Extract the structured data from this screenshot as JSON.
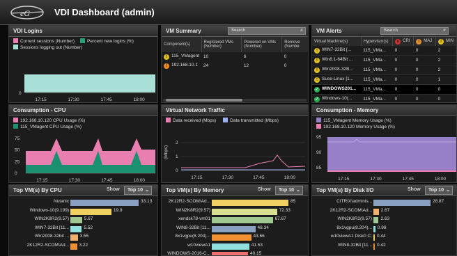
{
  "header": {
    "title": "VDI Dashboard (admin)"
  },
  "logins": {
    "title": "VDI Logins",
    "legend": [
      {
        "label": "Current sessions (Number)",
        "color": "#e97fb0"
      },
      {
        "label": "Percent new logins (%)",
        "color": "#27a07a"
      },
      {
        "label": "Sessions logging out (Number)",
        "color": "#a8e0d8"
      }
    ],
    "xticks": [
      "17:15",
      "17:30",
      "17:45",
      "18:00"
    ],
    "ytick": "0"
  },
  "summary": {
    "title": "VM Summary",
    "search": "Search",
    "cols": [
      "Component(s)",
      "Registered VMs (Number)",
      "Powered on VMs (Number)",
      "Remove (Numbe"
    ],
    "rows": [
      {
        "status": "!",
        "color": "#e0c020",
        "name": "115_VMagent",
        "reg": "10",
        "on": "6",
        "rem": "0"
      },
      {
        "status": "!",
        "color": "#f08a20",
        "name": "192.168.10.1",
        "reg": "24",
        "on": "12",
        "rem": "0"
      }
    ]
  },
  "alerts": {
    "title": "VM Alerts",
    "search": "Search",
    "cols": [
      "Virtual Machine(s)",
      "Hypervisor(s)",
      "CRI",
      "MAJ",
      "MIN"
    ],
    "rows": [
      {
        "icon": "!",
        "color": "#e0c020",
        "vm": "WIN7-32Bit [...",
        "hv": "115_VMa...",
        "cri": "0",
        "maj": "0",
        "min": "2"
      },
      {
        "icon": "!",
        "color": "#e0c020",
        "vm": "Win8.1-64Bit ...",
        "hv": "115_VMa...",
        "cri": "0",
        "maj": "0",
        "min": "2"
      },
      {
        "icon": "!",
        "color": "#e0c020",
        "vm": "Win2008-32B...",
        "hv": "115_VMa...",
        "cri": "0",
        "maj": "0",
        "min": "2"
      },
      {
        "icon": "!",
        "color": "#e0c020",
        "vm": "Suse-Linux [1...",
        "hv": "115_VMa...",
        "cri": "0",
        "maj": "0",
        "min": "1"
      },
      {
        "icon": "✓",
        "color": "#27b050",
        "vm": "WINDOWS201...",
        "hv": "115_VMa...",
        "cri": "0",
        "maj": "0",
        "min": "0"
      },
      {
        "icon": "✓",
        "color": "#27b050",
        "vm": "Windows-10(...",
        "hv": "115_VMa...",
        "cri": "0",
        "maj": "0",
        "min": "0"
      }
    ]
  },
  "cpu": {
    "title": "Consumption - CPU",
    "legend": [
      {
        "label": "192.168.10.120 CPU Usage (%)",
        "color": "#e97fb0"
      },
      {
        "label": "115_VMagent CPU Usage (%)",
        "color": "#1a9070"
      }
    ],
    "yticks": [
      "75",
      "50",
      "25",
      "0"
    ],
    "xticks": [
      "17:15",
      "17:30",
      "17:45",
      "18:00"
    ]
  },
  "net": {
    "title": "Virtual Network Traffic",
    "legend": [
      {
        "label": "Data received (Mbps)",
        "color": "#e97fb0"
      },
      {
        "label": "Data transmitted (Mbps)",
        "color": "#9ab0f0"
      }
    ],
    "ylabel": "(Mbps)",
    "yticks": [
      "2",
      "1",
      "0"
    ],
    "xticks": [
      "17:15",
      "17:30",
      "17:45",
      "18:00"
    ]
  },
  "mem": {
    "title": "Consumption - Memory",
    "legend": [
      {
        "label": "115_VMagent Memory Usage (%)",
        "color": "#9880c8"
      },
      {
        "label": "192.168.10.120 Memory Usage (%)",
        "color": "#e97fb0"
      }
    ],
    "yticks": [
      "95",
      "90",
      "85"
    ],
    "xticks": [
      "17:15",
      "17:30",
      "17:45",
      "18:00"
    ]
  },
  "topcpu": {
    "title": "Top VM(s) By CPU",
    "show": "Show",
    "select": "Top 10",
    "max": 33.13,
    "items": [
      {
        "name": "Nutanix",
        "value": 33.13,
        "color": "#8aa0c0"
      },
      {
        "name": "Windows-10(9.199)",
        "value": 19.9,
        "color": "#f0d060"
      },
      {
        "name": "WIN2K8R2(9.57)",
        "value": 5.67,
        "color": "#a0c890"
      },
      {
        "name": "WIN7-32Bit [11...",
        "value": 5.52,
        "color": "#90e0e0"
      },
      {
        "name": "Win2008-32bit ...",
        "value": 3.55,
        "color": "#f0b070"
      },
      {
        "name": "2K12R2-SCOM\\Ad...",
        "value": 3.22,
        "color": "#f09030"
      }
    ]
  },
  "topmem": {
    "title": "Top VM(s) By Memory",
    "show": "Show",
    "select": "Top 10",
    "max": 85,
    "items": [
      {
        "name": "2K12R2-SCOM\\Ad...",
        "value": 85,
        "color": "#f0d060"
      },
      {
        "name": "WIN2K8R2(9.57)",
        "value": 72.33,
        "color": "#d8e090"
      },
      {
        "name": "xendsk78-vm01",
        "value": 67.67,
        "color": "#a0c890"
      },
      {
        "name": "WIN8-32Bit [11...",
        "value": 48.34,
        "color": "#8aa0c0"
      },
      {
        "name": "8x1vgpu(8.204)...",
        "value": 43.66,
        "color": "#f09030"
      },
      {
        "name": "w10viewA1",
        "value": 41.53,
        "color": "#90e0e0"
      },
      {
        "name": "WINDOWS-2016-C...",
        "value": 40.15,
        "color": "#f07070"
      }
    ]
  },
  "topdisk": {
    "title": "Top VM(s) By Disk I/O",
    "show": "Show",
    "select": "Top 10",
    "max": 28.87,
    "items": [
      {
        "name": "CITRIX\\adminis...",
        "value": 28.87,
        "color": "#8aa0c0"
      },
      {
        "name": "2K12R2-SCOM\\Ad...",
        "value": 2.67,
        "color": "#f0b070"
      },
      {
        "name": "WIN2K8R2(9.57)",
        "value": 2.63,
        "color": "#a0c890"
      },
      {
        "name": "8x1vgpu(8.204)...",
        "value": 0.98,
        "color": "#90e0e0"
      },
      {
        "name": "w10viewA1 Disk0 C:",
        "value": 0.44,
        "color": "#f0d060"
      },
      {
        "name": "WIN8-32Bit [11...",
        "value": 0.42,
        "color": "#f09030"
      }
    ]
  }
}
